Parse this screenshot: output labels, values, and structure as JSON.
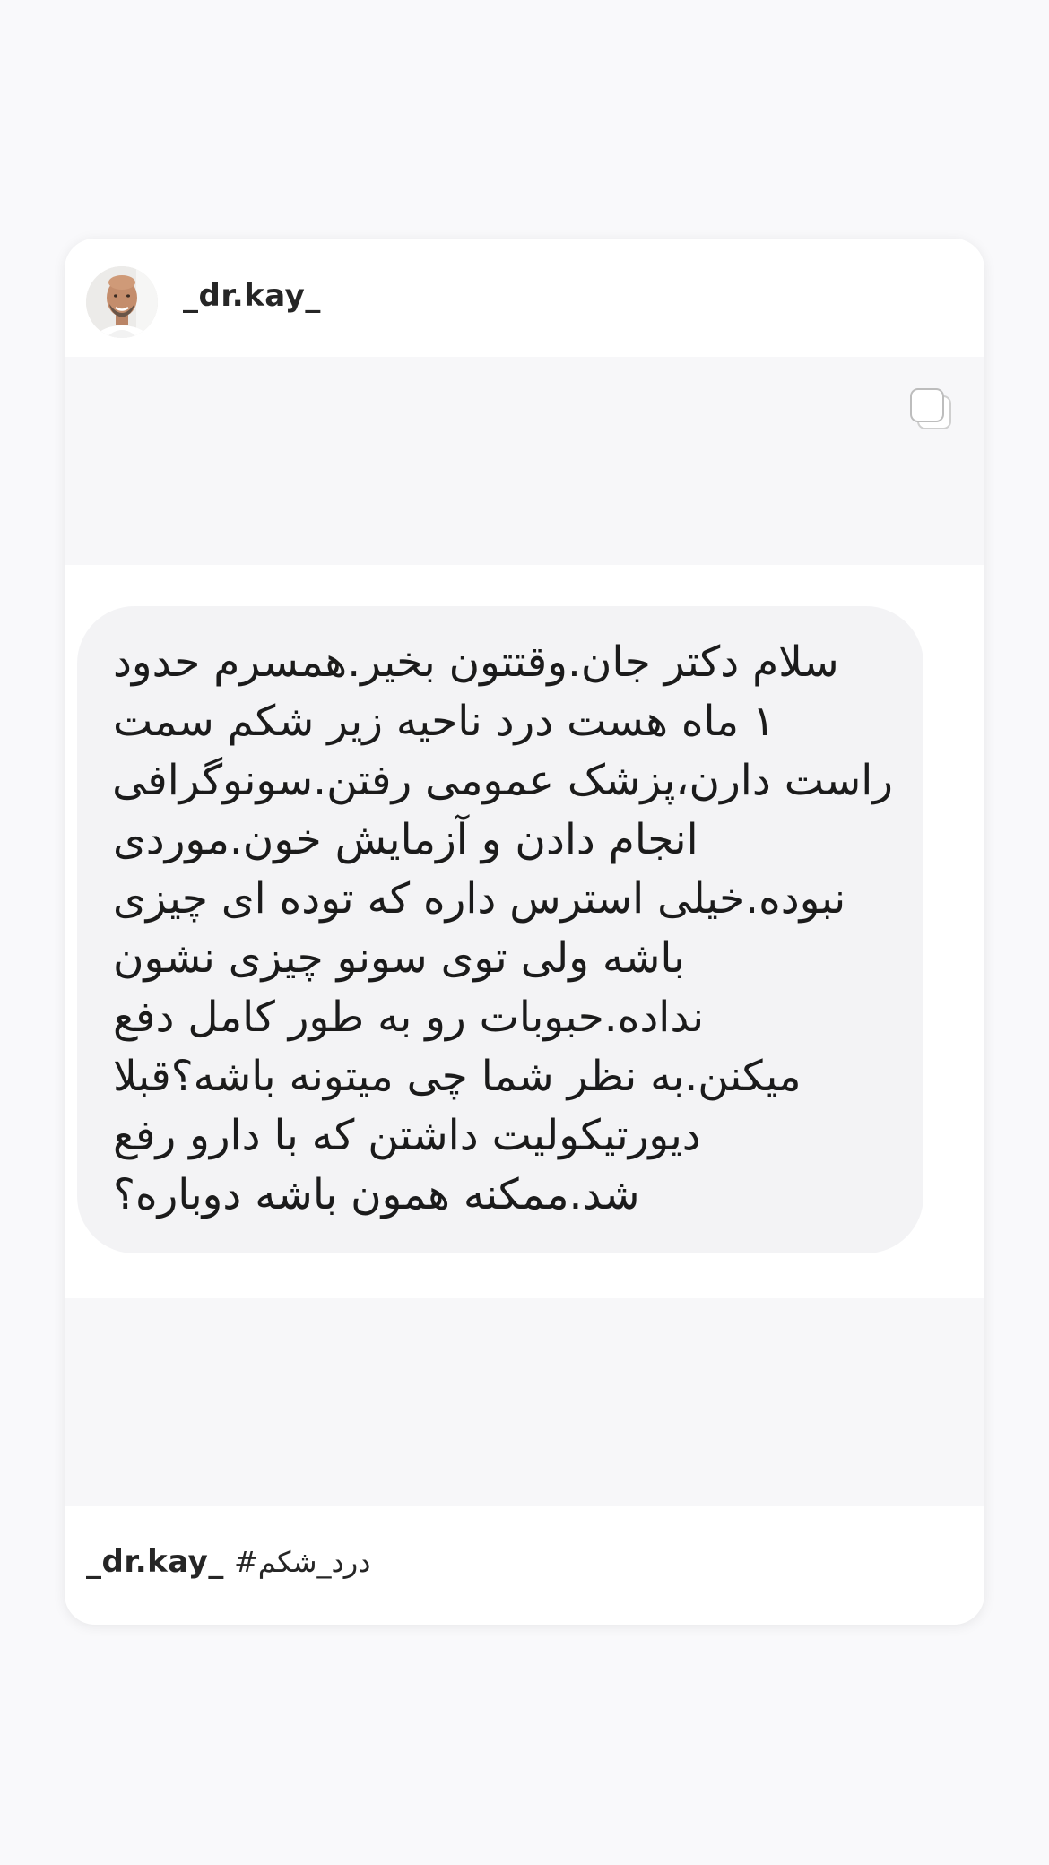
{
  "post": {
    "username": "_dr.kay_",
    "message_lines": [
      "سلام دکتر جان.وقتتون بخیر.همسرم حدود",
      "۱ ماه هست درد ناحیه زیر شکم سمت",
      "راست دارن،پزشک عمومی رفتن.سونوگرافی",
      "انجام دادن و آزمایش خون.موردی",
      "نبوده.خیلی استرس داره که توده ای چیزی",
      "باشه ولی توی سونو چیزی نشون",
      "نداده.حبوبات رو به طور کامل دفع",
      "میکنن.به نظر شما چی میتونه باشه؟قبلا",
      "دیورتیکولیت داشتن که با دارو رفع",
      "شد.ممکنه همون باشه دوباره؟"
    ]
  },
  "caption": {
    "username": "_dr.kay_",
    "hashtag": "#درد_شکم"
  },
  "icons": {
    "multi_post": "multiple-images-icon"
  },
  "colors": {
    "background": "#f9f9fb",
    "card": "#ffffff",
    "bubble": "#f3f3f5",
    "text": "#262626"
  }
}
